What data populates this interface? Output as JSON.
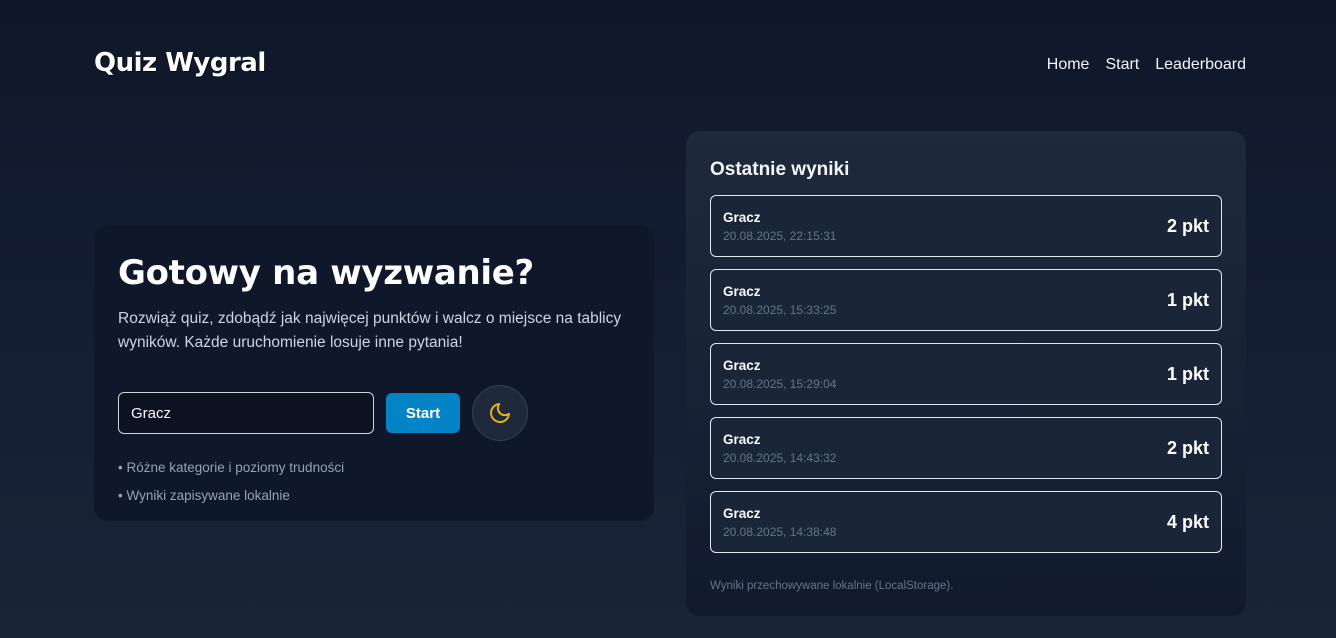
{
  "header": {
    "logo": "Quiz Wygral",
    "nav": [
      "Home",
      "Start",
      "Leaderboard"
    ]
  },
  "hero": {
    "title": "Gotowy na wyzwanie?",
    "description": "Rozwiąż quiz, zdobądź jak najwięcej punktów i walcz o miejsce na tablicy wyników. Każde uruchomienie losuje inne pytania!",
    "name_value": "Gracz",
    "start_label": "Start",
    "theme_icon": "moon-icon",
    "features": [
      "• Różne kategorie i poziomy trudności",
      "• Wyniki zapisywane lokalnie"
    ]
  },
  "results": {
    "title": "Ostatnie wyniki",
    "items": [
      {
        "name": "Gracz",
        "date": "20.08.2025, 22:15:31",
        "score": "2 pkt"
      },
      {
        "name": "Gracz",
        "date": "20.08.2025, 15:33:25",
        "score": "1 pkt"
      },
      {
        "name": "Gracz",
        "date": "20.08.2025, 15:29:04",
        "score": "1 pkt"
      },
      {
        "name": "Gracz",
        "date": "20.08.2025, 14:43:32",
        "score": "2 pkt"
      },
      {
        "name": "Gracz",
        "date": "20.08.2025, 14:38:48",
        "score": "4 pkt"
      }
    ],
    "note": "Wyniki przechowywane lokalnie (LocalStorage)."
  },
  "colors": {
    "accent": "#0284c7",
    "moon": "#eab308",
    "background": "#0f172a"
  }
}
